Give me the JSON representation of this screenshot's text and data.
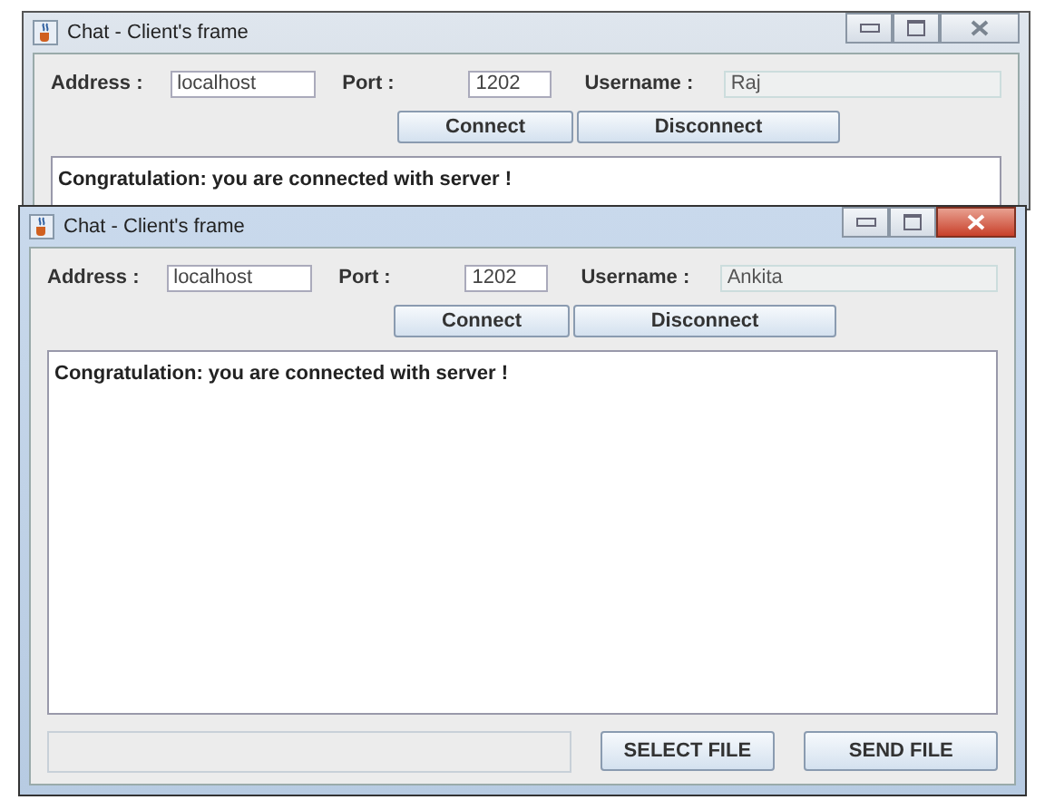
{
  "windows": [
    {
      "title": "Chat - Client's frame",
      "active": false,
      "address": {
        "label": "Address :",
        "value": "localhost"
      },
      "port": {
        "label": "Port :",
        "value": "1202"
      },
      "username": {
        "label": "Username :",
        "value": "Raj"
      },
      "buttons": [
        "Connect",
        "Disconnect"
      ],
      "log": "Congratulation: you are connected with server !"
    },
    {
      "title": "Chat - Client's frame",
      "active": true,
      "address": {
        "label": "Address :",
        "value": "localhost"
      },
      "port": {
        "label": "Port :",
        "value": "1202"
      },
      "username": {
        "label": "Username :",
        "value": "Ankita"
      },
      "buttons": [
        "Connect",
        "Disconnect"
      ],
      "log": "Congratulation: you are connected with server !",
      "file_buttons": [
        "SELECT FILE",
        "SEND FILE"
      ]
    }
  ]
}
